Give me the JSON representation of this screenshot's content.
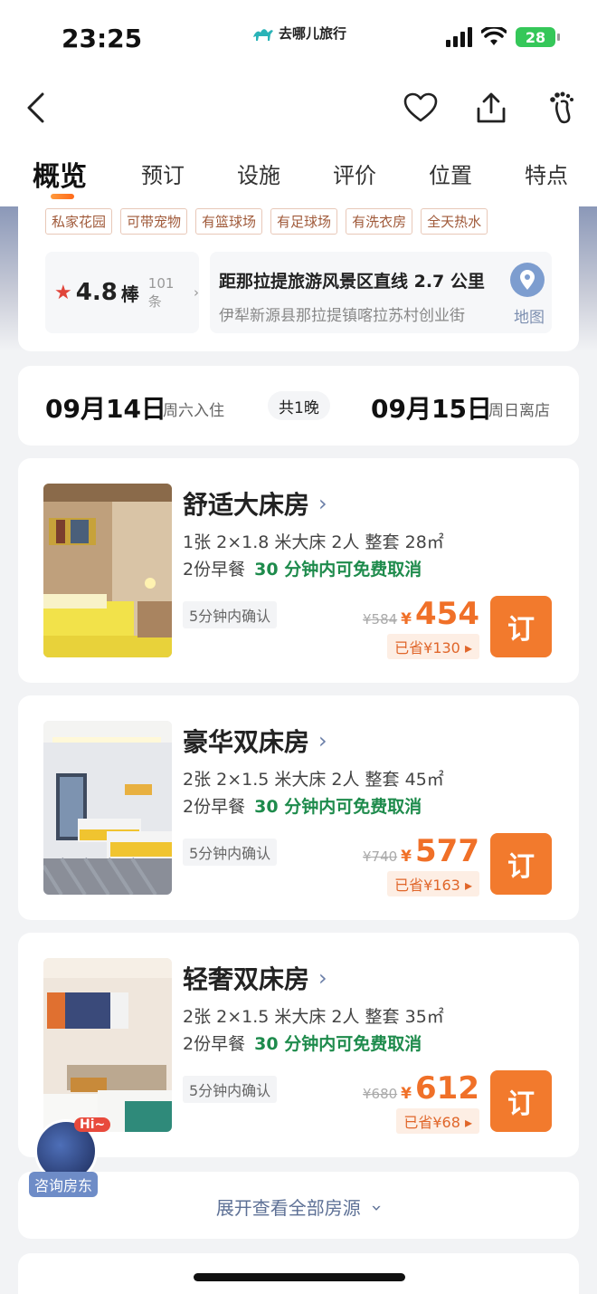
{
  "status_bar": {
    "time": "23:25",
    "brand": "去哪儿旅行",
    "battery": "28"
  },
  "nav": {
    "back_icon": "chevron-left-icon",
    "favorite_icon": "heart-icon",
    "share_icon": "share-icon",
    "footprint_icon": "footprint-icon"
  },
  "tabs": [
    {
      "label": "概览",
      "active": true
    },
    {
      "label": "预订"
    },
    {
      "label": "设施"
    },
    {
      "label": "评价"
    },
    {
      "label": "位置"
    },
    {
      "label": "特点"
    }
  ],
  "facility_tags": [
    "私家花园",
    "可带宠物",
    "有篮球场",
    "有足球场",
    "有洗衣房",
    "全天热水"
  ],
  "rating": {
    "score": "4.8",
    "word": "棒",
    "count": "101条",
    "star_color": "#e0443a"
  },
  "location": {
    "title": "距那拉提旅游风景区直线 2.7 公里",
    "address": "伊犁新源县那拉提镇喀拉苏村创业街",
    "map_label": "地图"
  },
  "dates": {
    "checkin_date": "09月14日",
    "checkin_label": "周六入住",
    "nights": "共1晚",
    "checkout_date": "09月15日",
    "checkout_label": "周日离店"
  },
  "rooms": [
    {
      "name": "舒适大床房",
      "spec": "1张 2×1.8 米大床  2人  整套  28㎡",
      "meal": "2份早餐",
      "cancel": "30 分钟内可免费取消",
      "confirm": "5分钟内确认",
      "original_price": "¥584",
      "currency": "¥",
      "price": "454",
      "saved": "已省¥130",
      "book_label": "订"
    },
    {
      "name": "豪华双床房",
      "spec": "2张 2×1.5 米大床  2人  整套  45㎡",
      "meal": "2份早餐",
      "cancel": "30 分钟内可免费取消",
      "confirm": "5分钟内确认",
      "original_price": "¥740",
      "currency": "¥",
      "price": "577",
      "saved": "已省¥163",
      "book_label": "订"
    },
    {
      "name": "轻奢双床房",
      "spec": "2张 2×1.5 米大床  2人  整套  35㎡",
      "meal": "2份早餐",
      "cancel": "30 分钟内可免费取消",
      "confirm": "5分钟内确认",
      "original_price": "¥680",
      "currency": "¥",
      "price": "612",
      "saved": "已省¥68",
      "book_label": "订"
    }
  ],
  "expand_label": "展开查看全部房源",
  "consult": {
    "hi": "Hi~",
    "label": "咨询房东"
  },
  "colors": {
    "accent_orange": "#f27a2d",
    "free_cancel_green": "#1e8b4c",
    "link_blue": "#5e7196"
  }
}
